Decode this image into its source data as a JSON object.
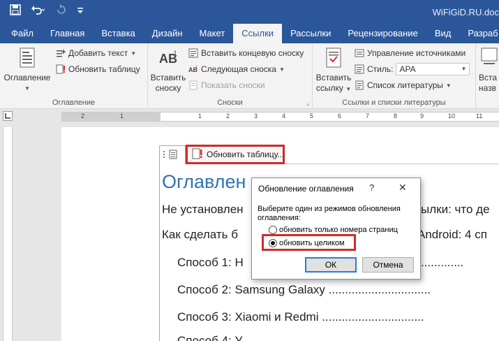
{
  "window": {
    "title": "WiFiGiD.RU.doc"
  },
  "tabs": [
    "Файл",
    "Главная",
    "Вставка",
    "Дизайн",
    "Макет",
    "Ссылки",
    "Рассылки",
    "Рецензирование",
    "Вид",
    "Разраб"
  ],
  "ribbon": {
    "toc_group": {
      "big_button": "Оглавление",
      "add_text": "Добавить текст",
      "update_table": "Обновить таблицу",
      "label": "Оглавление"
    },
    "footnotes_group": {
      "big_line1": "Вставить",
      "big_line2": "сноску",
      "insert_endnote": "Вставить концевую сноску",
      "next_footnote": "Следующая сноска",
      "show_notes": "Показать сноски",
      "label": "Сноски"
    },
    "citations_group": {
      "big_line1": "Вставить",
      "big_line2": "ссылку",
      "manage_sources": "Управление источниками",
      "style_label": "Стиль:",
      "style_value": "APA",
      "bibliography": "Список литературы",
      "label": "Ссылки и списки литературы"
    },
    "captions_group": {
      "big_line1": "Вста",
      "big_line2": "назв"
    }
  },
  "ruler": {
    "labels": [
      "2",
      "1",
      "1",
      "2",
      "3",
      "4",
      "5",
      "6",
      "7",
      "8",
      "9",
      "10",
      "11"
    ]
  },
  "toc_control": {
    "update_button": "Обновить таблицу..."
  },
  "document": {
    "title": "Оглавлен",
    "lines": [
      "Не установлен",
      "ылки: что де",
      "Как сделать б",
      "Android: 4 сп",
      "Способ 1: Н",
      "Способ 2: Samsung Galaxy ...............................",
      "Способ 3: Xiaomi и Redmi ...............................",
      "Способ 4: У"
    ]
  },
  "dialog": {
    "title": "Обновление оглавления",
    "help": "?",
    "close": "✕",
    "prompt": "Выберите один из режимов обновления оглавления:",
    "option_pages": "обновить только номера страниц",
    "option_full": "обновить целиком",
    "selected": "обновить целиком",
    "ok": "ОК",
    "cancel": "Отмена"
  }
}
